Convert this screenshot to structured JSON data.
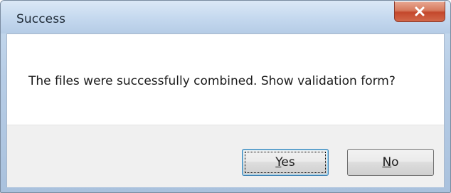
{
  "window": {
    "title": "Success",
    "close_icon": "close-icon"
  },
  "message": {
    "text": "The files were successfully combined. Show validation form?"
  },
  "buttons": {
    "yes": {
      "mnemonic": "Y",
      "rest": "es"
    },
    "no": {
      "mnemonic": "N",
      "rest": "o"
    }
  },
  "colors": {
    "titlebar": "#c4d8ee",
    "close_button": "#c4482c",
    "client_bg": "#ffffff",
    "button_area_bg": "#f0f0f0",
    "default_button_border": "#3c7fb1"
  }
}
